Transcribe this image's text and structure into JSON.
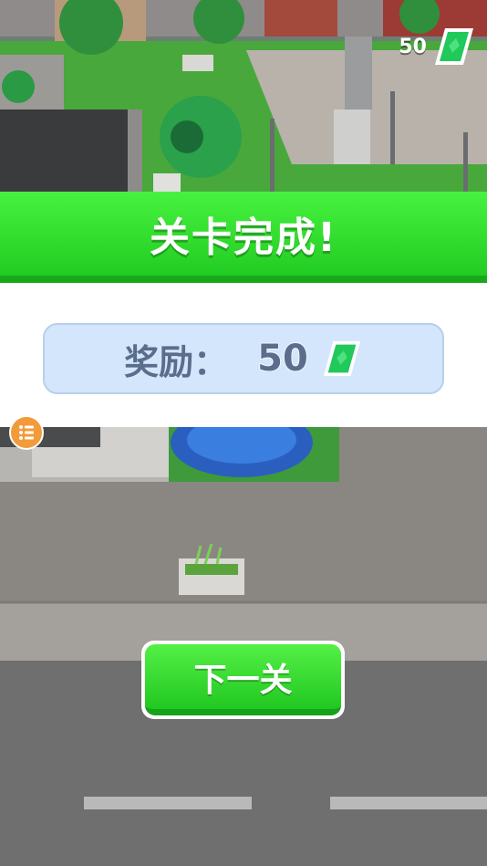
{
  "hud": {
    "currency_value": "50",
    "currency_icon": "green-gem-icon"
  },
  "result": {
    "title": "关卡完成!",
    "reward_label": "奖励：",
    "reward_value": "50",
    "reward_icon": "green-gem-icon"
  },
  "buttons": {
    "next_label": "下一关",
    "menu_icon": "list-icon"
  },
  "colors": {
    "banner_green": "#2fdc2c",
    "reward_bg": "#d4e6fb",
    "reward_text": "#5b6d8c",
    "menu_orange": "#f39a3a"
  }
}
